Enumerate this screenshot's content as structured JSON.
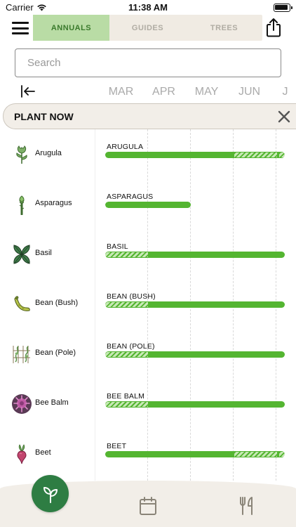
{
  "status": {
    "carrier": "Carrier",
    "time": "11:38 AM"
  },
  "tabs": [
    {
      "label": "ANNUALS",
      "active": true
    },
    {
      "label": "GUIDES",
      "active": false
    },
    {
      "label": "TREES",
      "active": false
    }
  ],
  "search": {
    "placeholder": "Search",
    "value": ""
  },
  "months": [
    "MAR",
    "APR",
    "MAY",
    "JUN",
    "J"
  ],
  "plant_now": {
    "label": "PLANT NOW"
  },
  "plants": [
    {
      "name": "Arugula",
      "bar_label": "ARUGULA",
      "icon": "arugula-icon"
    },
    {
      "name": "Asparagus",
      "bar_label": "ASPARAGUS",
      "icon": "asparagus-icon"
    },
    {
      "name": "Basil",
      "bar_label": "BASIL",
      "icon": "basil-icon"
    },
    {
      "name": "Bean (Bush)",
      "bar_label": "BEAN (BUSH)",
      "icon": "bean-bush-icon"
    },
    {
      "name": "Bean (Pole)",
      "bar_label": "BEAN (POLE)",
      "icon": "bean-pole-icon"
    },
    {
      "name": "Bee Balm",
      "bar_label": "BEE BALM",
      "icon": "bee-balm-icon"
    },
    {
      "name": "Beet",
      "bar_label": "BEET",
      "icon": "beet-icon"
    }
  ],
  "colors": {
    "accent": "#54b531",
    "tab_active_bg": "#b9dca5",
    "tab_active_text": "#3a7a2c",
    "fab": "#2e7d43",
    "surface": "#f2eee8"
  },
  "nav": {
    "fab_icon": "seedling-icon",
    "calendar_icon": "calendar-icon",
    "recipes_icon": "fork-knife-icon"
  }
}
